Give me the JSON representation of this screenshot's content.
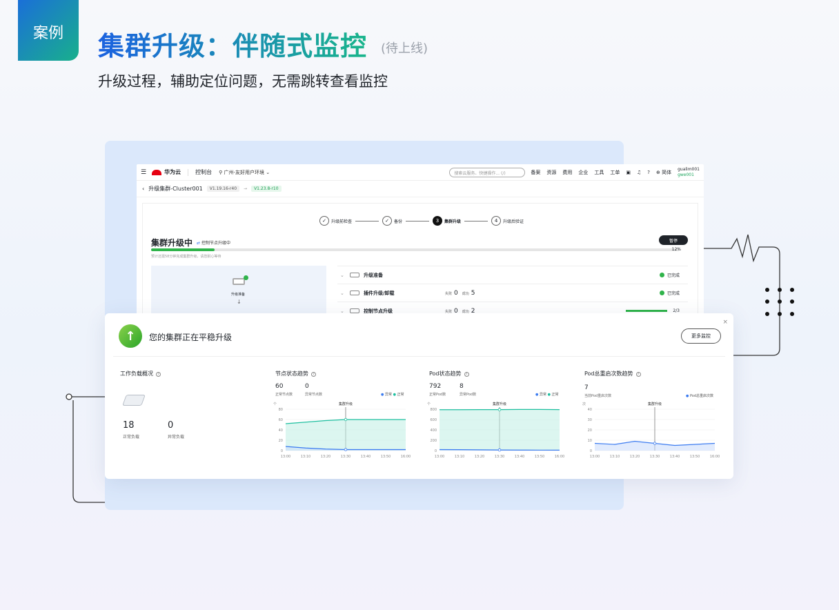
{
  "header": {
    "badge": "案例",
    "title": "集群升级：伴随式监控",
    "title_note": "(待上线)",
    "subtitle": "升级过程，辅助定位问题，无需跳转查看监控"
  },
  "console": {
    "topbar": {
      "brand": "华为云",
      "console": "控制台",
      "region": "广州-友好用户环境",
      "search_placeholder": "搜索云服务、快捷操作... (/)",
      "nav": [
        "备案",
        "资源",
        "费用",
        "企业",
        "工具",
        "工单"
      ],
      "lang": "简体",
      "user": "gualim001",
      "user_id": "gwe001"
    },
    "breadcrumb": {
      "title": "升级集群-Cluster001",
      "from_version": "V1.19.16-r40",
      "to_version": "V1.23.8-r10"
    },
    "steps": [
      "升级前检查",
      "备份",
      "集群升级",
      "升级后验证"
    ],
    "active_step": "3",
    "last_step": "4",
    "upgrade": {
      "title": "集群升级中",
      "tag": "控制节点升级中",
      "pause": "暂停",
      "percent_label": "12%",
      "progress": 0.12,
      "hint": "预计还需58分钟完成集群升级，请您耐心等待"
    },
    "flow": {
      "label": "升级准备"
    },
    "rows": [
      {
        "name": "升级准备",
        "status": "已完成"
      },
      {
        "name": "插件升级/卸载",
        "fail_label": "失败",
        "fail": "0",
        "success_label": "成功",
        "success": "5",
        "status": "已完成"
      },
      {
        "name": "控制节点升级",
        "fail_label": "失败",
        "fail": "0",
        "success_label": "成功",
        "success": "2",
        "status": "2/3"
      }
    ]
  },
  "card": {
    "title": "您的集群正在平稳升级",
    "more": "更多监控",
    "close": "×",
    "workload": {
      "title": "工作负载概况",
      "normal": "18",
      "normal_label": "正常负载",
      "abnormal": "0",
      "abnormal_label": "异常负载"
    },
    "node": {
      "title": "节点状态趋势",
      "v1": "60",
      "l1": "正常节点数",
      "v2": "0",
      "l2": "异常节点数",
      "legend": [
        "异常",
        "正常"
      ]
    },
    "pod": {
      "title": "Pod状态趋势",
      "v1": "792",
      "l1": "正常Pod数",
      "v2": "8",
      "l2": "异常Pod数",
      "legend": [
        "异常",
        "正常"
      ]
    },
    "restart": {
      "title": "Pod总重启次数趋势",
      "v1": "7",
      "l1": "当前Pod重启次数",
      "legend": [
        "Pod总重启次数"
      ]
    }
  },
  "chart_data": [
    {
      "type": "area",
      "title": "节点状态趋势",
      "unit": "个",
      "marker": "集群升级",
      "x": [
        "13:00",
        "13:10",
        "13:20",
        "13:30",
        "13:40",
        "13:50",
        "16:00"
      ],
      "ylim": [
        0,
        80
      ],
      "yticks": [
        0,
        20,
        40,
        60,
        80
      ],
      "series": [
        {
          "name": "正常",
          "values": [
            52,
            55,
            58,
            60,
            60,
            60,
            60
          ]
        },
        {
          "name": "异常",
          "values": [
            8,
            5,
            3,
            2,
            2,
            2,
            2
          ]
        }
      ]
    },
    {
      "type": "area",
      "title": "Pod状态趋势",
      "unit": "个",
      "marker": "集群升级",
      "x": [
        "13:00",
        "13:10",
        "13:20",
        "13:30",
        "13:40",
        "13:50",
        "16:00"
      ],
      "ylim": [
        0,
        800
      ],
      "yticks": [
        0,
        200,
        400,
        600,
        800
      ],
      "series": [
        {
          "name": "正常",
          "values": [
            790,
            790,
            792,
            792,
            795,
            795,
            792
          ]
        },
        {
          "name": "异常",
          "values": [
            20,
            18,
            15,
            12,
            10,
            9,
            8
          ]
        }
      ]
    },
    {
      "type": "area",
      "title": "Pod总重启次数趋势",
      "unit": "次",
      "marker": "集群升级",
      "x": [
        "13:00",
        "13:10",
        "13:20",
        "13:30",
        "13:40",
        "13:50",
        "16:00"
      ],
      "ylim": [
        0,
        40
      ],
      "yticks": [
        0,
        10,
        20,
        30,
        40
      ],
      "series": [
        {
          "name": "Pod总重启次数",
          "values": [
            7,
            6,
            9,
            7,
            5,
            6,
            7
          ]
        }
      ]
    }
  ],
  "colors": {
    "green": "#2fb34a",
    "teal": "#1dbf9f",
    "blue": "#3b7bf0"
  }
}
